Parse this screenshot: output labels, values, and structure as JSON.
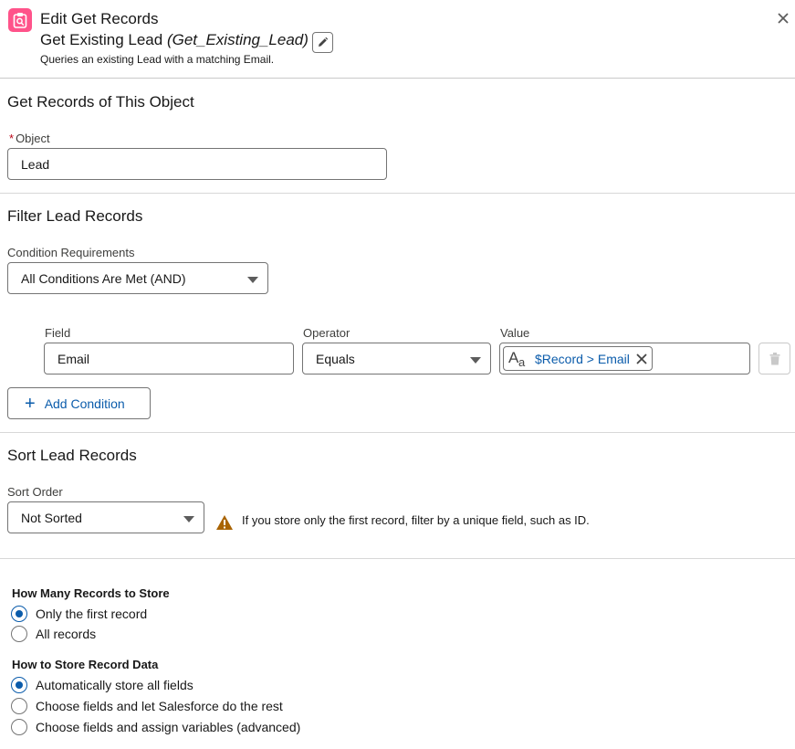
{
  "header": {
    "title": "Edit Get Records",
    "element_label": "Get Existing Lead",
    "element_api": "(Get_Existing_Lead)",
    "description": "Queries an existing Lead with a matching Email.",
    "icon": "get-records-icon",
    "accent_color": "#ff538a"
  },
  "object_section": {
    "title": "Get Records of This Object",
    "required_marker": "*",
    "object_label": "Object",
    "object_value": "Lead"
  },
  "filter_section": {
    "title": "Filter Lead Records",
    "condition_label": "Condition Requirements",
    "condition_value": "All Conditions Are Met (AND)",
    "columns": {
      "field": "Field",
      "operator": "Operator",
      "value": "Value"
    },
    "row": {
      "field": "Email",
      "operator": "Equals",
      "value_icon": "text-type-icon",
      "value_icon_a": "A",
      "value_icon_sub": "a",
      "value": "$Record > Email"
    },
    "add_condition_label": "Add Condition"
  },
  "sort_section": {
    "title": "Sort Lead Records",
    "sort_label": "Sort Order",
    "sort_value": "Not Sorted",
    "warning": "If you store only the first record, filter by a unique field, such as ID.",
    "warning_color": "#a96404"
  },
  "store_section": {
    "how_many_label": "How Many Records to Store",
    "how_many_options": [
      {
        "label": "Only the first record",
        "checked": true
      },
      {
        "label": "All records",
        "checked": false
      }
    ],
    "how_store_label": "How to Store Record Data",
    "how_store_options": [
      {
        "label": "Automatically store all fields",
        "checked": true
      },
      {
        "label": "Choose fields and let Salesforce do the rest",
        "checked": false
      },
      {
        "label": "Choose fields and assign variables (advanced)",
        "checked": false
      }
    ]
  }
}
